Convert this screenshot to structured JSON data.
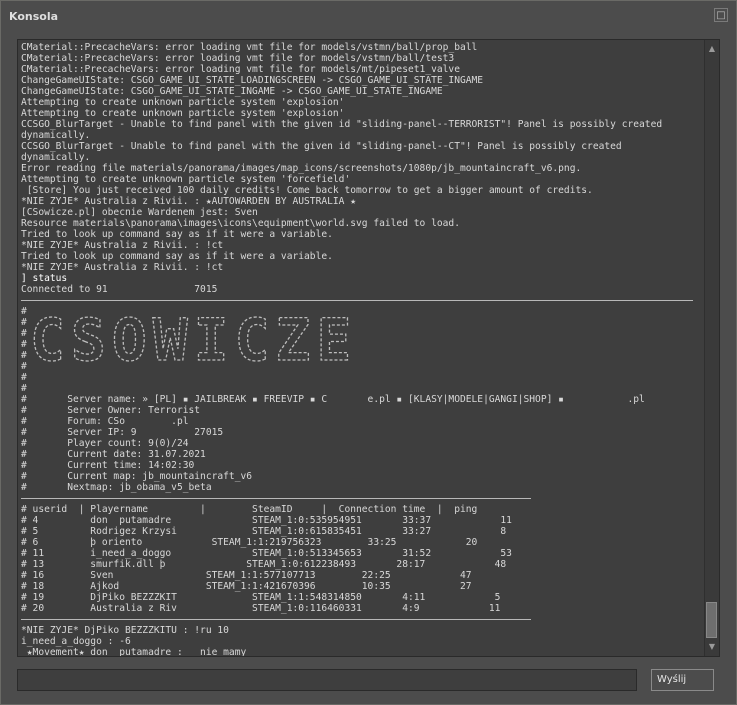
{
  "window": {
    "title": "Konsola",
    "close_glyph": "□"
  },
  "console": {
    "lines": [
      {
        "text": "CMaterial::PrecacheVars: error loading vmt file for models/vstmn/ball/prop_ball"
      },
      {
        "text": "CMaterial::PrecacheVars: error loading vmt file for models/vstmn/ball/test3"
      },
      {
        "text": "CMaterial::PrecacheVars: error loading vmt file for models/mt/pipeset1_valve"
      },
      {
        "text": "ChangeGameUIState: CSGO_GAME_UI_STATE_LOADINGSCREEN -> CSGO_GAME_UI_STATE_INGAME"
      },
      {
        "text": "ChangeGameUIState: CSGO_GAME_UI_STATE_INGAME -> CSGO_GAME_UI_STATE_INGAME"
      },
      {
        "text": "Attempting to create unknown particle system 'explosion'"
      },
      {
        "text": "Attempting to create unknown particle system 'explosion'"
      },
      {
        "text": "CCSGO_BlurTarget - Unable to find panel with the given id \"sliding-panel--TERRORIST\"! Panel is possibly created"
      },
      {
        "text": "dynamically."
      },
      {
        "text": "CCSGO_BlurTarget - Unable to find panel with the given id \"sliding-panel--CT\"! Panel is possibly created"
      },
      {
        "text": "dynamically."
      },
      {
        "text": "Error reading file materials/panorama/images/map_icons/screenshots/1080p/jb_mountaincraft_v6.png."
      },
      {
        "text": "Attempting to create unknown particle system 'forcefield'"
      },
      {
        "text": " [Store] You just received 100 daily credits! Come back tomorrow to get a bigger amount of credits."
      },
      {
        "text": "*NIE ŻYJE* Australia z Rivii. : ★AUTOWARDEN BY AUSTRALIA ★"
      },
      {
        "text": "[CSowicze.pl] obecnie Wardenem jest: Sven"
      },
      {
        "text": "Resource materials\\panorama\\images\\icons\\equipment\\world.svg failed to load."
      },
      {
        "text": "Tried to look up command say as if it were a variable."
      },
      {
        "text": "*NIE ŻYJE* Australia z Rivii. : !ct"
      },
      {
        "text": "Tried to look up command say as if it were a variable."
      },
      {
        "text": "*NIE ŻYJE* Australia z Rivii. : !ct"
      },
      {
        "text": "] status",
        "bright": true
      },
      {
        "text": "Connected to 91               7015"
      },
      {
        "rule": "long"
      },
      {
        "text": "#"
      },
      {
        "text": "#"
      },
      {
        "text": "#"
      },
      {
        "text": "#"
      },
      {
        "text": "#"
      },
      {
        "text": "#"
      },
      {
        "text": "#"
      },
      {
        "text": "#"
      },
      {
        "text": "#       Server name: » [PL] ▪ JAILBREAK ▪ FREEVIP ▪ C       e.pl ▪ [KLASY|MODELE|GANGI|SHOP] ▪           .pl"
      },
      {
        "text": "#       Server Owner: Terrorist"
      },
      {
        "text": "#       Forum: CSo        .pl"
      },
      {
        "text": "#       Server IP: 9          27015"
      },
      {
        "text": "#       Player count: 9(0)/24"
      },
      {
        "text": "#       Current date: 31.07.2021"
      },
      {
        "text": "#       Current time: 14:02:30"
      },
      {
        "text": "#       Current map: jb_mountaincraft_v6"
      },
      {
        "text": "#       Nextmap: jb_obama_v5_beta"
      },
      {
        "rule": "short"
      },
      {
        "text": "# userid  | Playername         |        SteamID     |  Connection time  |  ping"
      },
      {
        "text": "# 4         don  putamadre              STEAM_1:0:535954951       33:37            11"
      },
      {
        "text": "# 5         Rodrigez Krzysi             STEAM_1:0:615835451       33:27            8"
      },
      {
        "text": "# 6         þ oriento            STEAM_1:1:219756323        33:25            20"
      },
      {
        "text": "# 11        i_need_a_doggo              STEAM_1:0:513345653       31:52            53"
      },
      {
        "text": "# 13        smurfik.dll þ              STEAM_1:0:612238493       28:17            48"
      },
      {
        "text": "# 16        Sven                STEAM_1:1:577107713        22:25            47"
      },
      {
        "text": "# 18        Ajkod               STEAM_1:1:421670396        10:35            27"
      },
      {
        "text": "# 19        DjPiko BEZZZKIT             STEAM_1:1:548314850       4:11            5"
      },
      {
        "text": "# 20        Australia z Riv             STEAM_1:0:116460331       4:9            11"
      },
      {
        "rule": "short"
      },
      {
        "text": "*NIE ŻYJE* DjPiko BEZZZKITU : !ru 10"
      },
      {
        "text": "i_need_a_doggo : -6"
      },
      {
        "text": " ★Movement★ don  putamadre :   nie mamy"
      }
    ],
    "ascii_banner": "CSOWICZE"
  },
  "scrollbar": {
    "up_glyph": "▲",
    "down_glyph": "▼"
  },
  "command": {
    "value": "",
    "send_label": "Wyślij"
  },
  "colors": {
    "window_bg": "#4c4c4c",
    "console_bg": "#3e3e3e",
    "text": "#d8d8d8"
  }
}
